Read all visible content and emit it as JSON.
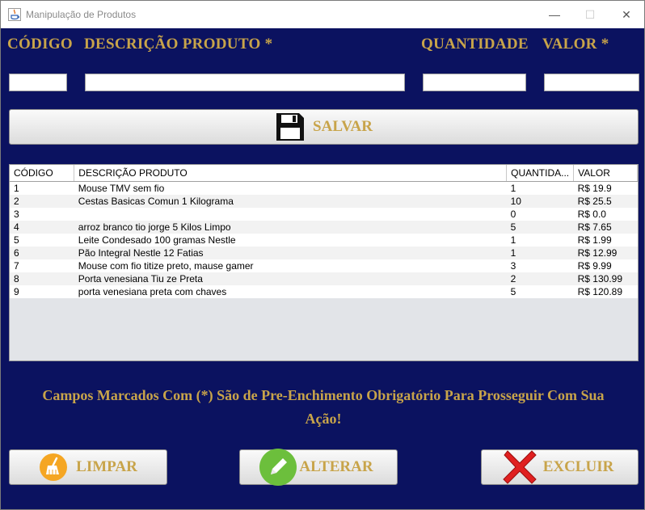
{
  "window": {
    "title": "Manipulação de Produtos",
    "minimize_glyph": "—",
    "maximize_glyph": "☐",
    "close_glyph": "✕"
  },
  "form": {
    "codigo_label": "CÓDIGO",
    "descricao_label": "DESCRIÇÃO PRODUTO *",
    "quantidade_label": "QUANTIDADE",
    "valor_label": "VALOR *",
    "codigo_value": "",
    "descricao_value": "",
    "quantidade_value": "",
    "valor_value": ""
  },
  "salvar_button": {
    "label": "SALVAR",
    "icon": "floppy-disk-icon"
  },
  "table": {
    "headers": [
      "CÓDIGO",
      "DESCRIÇÃO PRODUTO",
      "QUANTIDA...",
      "VALOR"
    ],
    "rows": [
      [
        "1",
        "Mouse TMV sem fio",
        "1",
        "R$ 19.9"
      ],
      [
        "2",
        "Cestas Basicas Comun 1 Kilograma",
        "10",
        "R$ 25.5"
      ],
      [
        "3",
        "",
        "0",
        "R$ 0.0"
      ],
      [
        "4",
        "arroz branco tio jorge 5 Kilos Limpo",
        "5",
        "R$ 7.65"
      ],
      [
        "5",
        "Leite Condesado 100 gramas Nestle",
        "1",
        "R$ 1.99"
      ],
      [
        "6",
        "Pão Integral Nestle 12 Fatias",
        "1",
        "R$ 12.99"
      ],
      [
        "7",
        "Mouse com fio titize preto, mause gamer",
        "3",
        "R$ 9.99"
      ],
      [
        "8",
        "Porta venesiana Tiu ze Preta",
        "2",
        "R$ 130.99"
      ],
      [
        "9",
        "porta venesiana preta com chaves",
        "5",
        "R$ 120.89"
      ]
    ]
  },
  "note": {
    "line1": "Campos Marcados Com (*) São de Pre-Enchimento Obrigatório Para Prosseguir Com Sua",
    "line2": "Ação!"
  },
  "buttons": {
    "limpar": {
      "label": "LIMPAR",
      "icon": "broom-icon"
    },
    "alterar": {
      "label": "ALTERAR",
      "icon": "pencil-icon"
    },
    "excluir": {
      "label": "EXCLUIR",
      "icon": "red-x-icon"
    }
  },
  "colors": {
    "background": "#0b1260",
    "label_gold": "#c8a44a",
    "excluir_red": "#e02020",
    "alterar_green": "#6cbf3c",
    "limpar_orange": "#f5a623"
  }
}
